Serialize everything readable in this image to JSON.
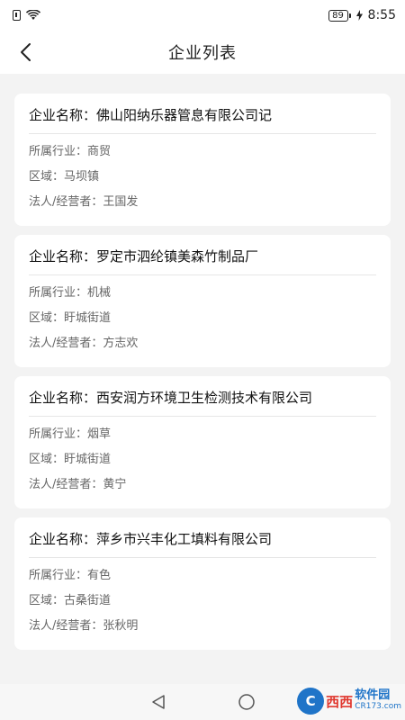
{
  "status_bar": {
    "battery": "89",
    "time": "8:55"
  },
  "header": {
    "title": "企业列表"
  },
  "companies": [
    {
      "name": "企业名称：佛山阳纳乐器管息有限公司记",
      "industry": "所属行业：商贸",
      "area": "区域：马坝镇",
      "legal": "法人/经营者：王国发"
    },
    {
      "name": "企业名称：罗定市泗纶镇美森竹制品厂",
      "industry": "所属行业：机械",
      "area": "区域：盱城街道",
      "legal": "法人/经营者：方志欢"
    },
    {
      "name": "企业名称：西安润方环境卫生检测技术有限公司",
      "industry": "所属行业：烟草",
      "area": "区域：盱城街道",
      "legal": "法人/经营者：黄宁"
    },
    {
      "name": "企业名称：萍乡市兴丰化工填料有限公司",
      "industry": "所属行业：有色",
      "area": "区域：古桑街道",
      "legal": "法人/经营者：张秋明"
    }
  ],
  "watermark": {
    "main": "西西",
    "sub": "软件园",
    "url": "CR173.com"
  },
  "icons": {
    "back": "chevron-left-icon",
    "nav_back": "triangle-back-icon",
    "nav_home": "circle-home-icon"
  }
}
